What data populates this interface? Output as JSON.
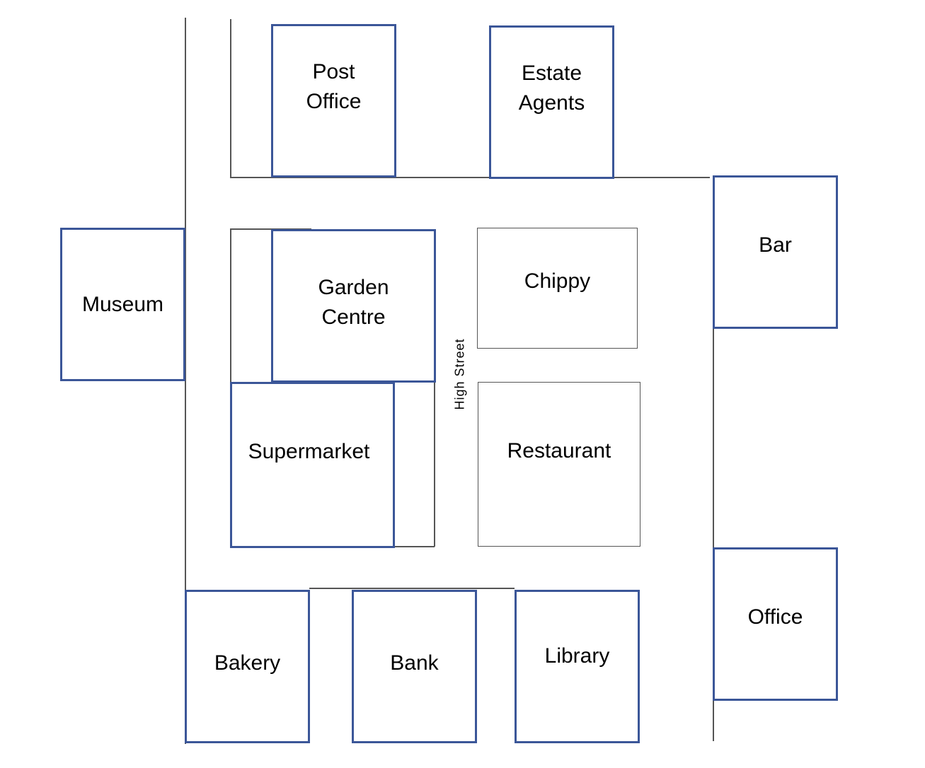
{
  "map": {
    "street_label": "High Street",
    "buildings": {
      "post_office": "Post\nOffice",
      "estate_agents": "Estate\nAgents",
      "bar": "Bar",
      "museum": "Museum",
      "garden_centre": "Garden\nCentre",
      "chippy": "Chippy",
      "supermarket": "Supermarket",
      "restaurant": "Restaurant",
      "bakery": "Bakery",
      "bank": "Bank",
      "library": "Library",
      "office": "Office"
    },
    "colors": {
      "building_outline": "#3b5698",
      "road_line": "#555555"
    }
  }
}
